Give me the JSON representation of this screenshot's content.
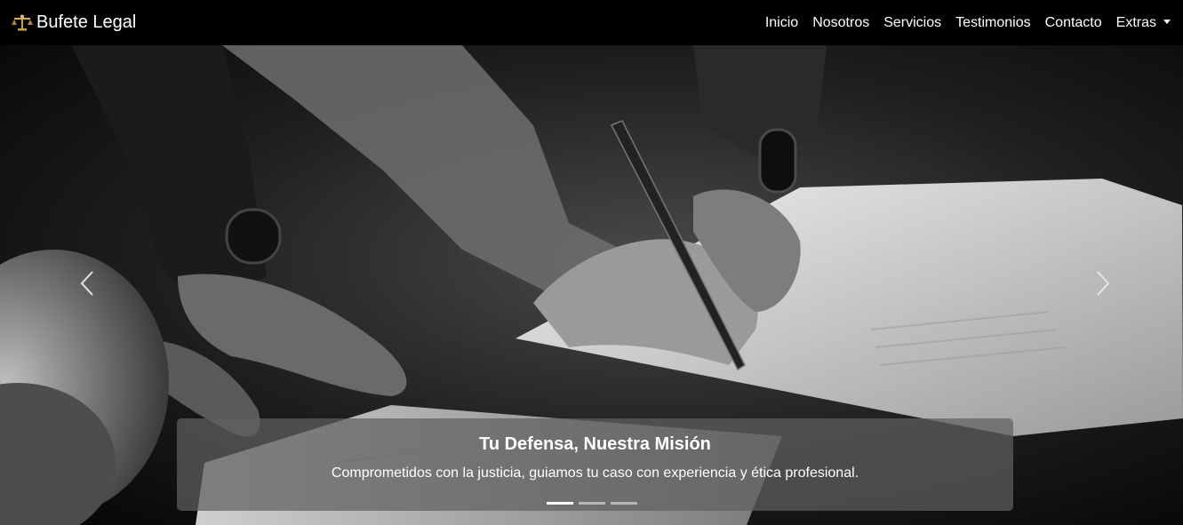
{
  "brand": {
    "name": "Bufete Legal",
    "logo_icon": "scales-of-justice-icon"
  },
  "nav": {
    "items": [
      {
        "label": "Inicio"
      },
      {
        "label": "Nosotros"
      },
      {
        "label": "Servicios"
      },
      {
        "label": "Testimonios"
      },
      {
        "label": "Contacto"
      },
      {
        "label": "Extras"
      }
    ]
  },
  "carousel": {
    "slide_count": 3,
    "active_index": 0,
    "caption": {
      "title": "Tu Defensa, Nuestra Misión",
      "text": "Comprometidos con la justicia, guiamos tu caso con experiencia y ética profesional."
    },
    "prev_icon": "chevron-left-icon",
    "next_icon": "chevron-right-icon"
  },
  "colors": {
    "navbar_bg": "#000000",
    "caption_bg": "#5f5f5f",
    "text": "#ffffff"
  }
}
